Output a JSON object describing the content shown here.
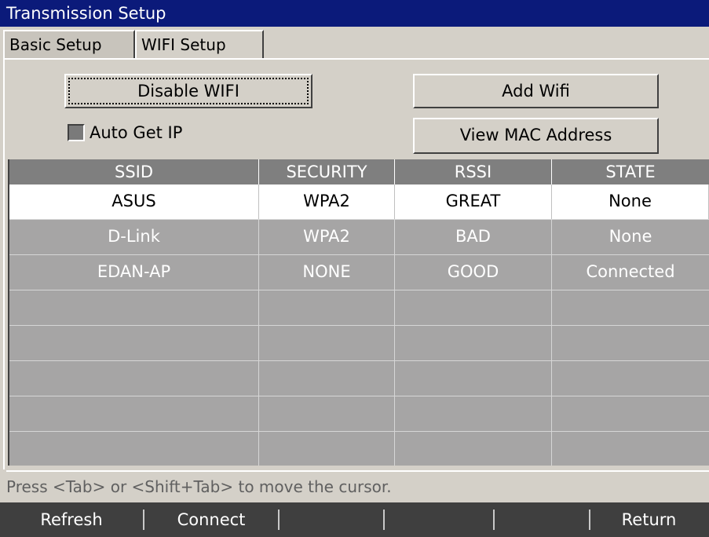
{
  "window": {
    "title": "Transmission Setup"
  },
  "tabs": [
    {
      "label": "Basic Setup"
    },
    {
      "label": "WIFI Setup"
    }
  ],
  "buttons": {
    "disable_wifi": "Disable WIFI",
    "add_wifi": "Add Wifi",
    "view_mac": "View MAC Address"
  },
  "auto_get_ip": {
    "label": "Auto Get IP",
    "checked": false
  },
  "table": {
    "headers": [
      "SSID",
      "SECURITY",
      "RSSI",
      "STATE"
    ],
    "rows": [
      [
        "ASUS",
        "WPA2",
        "GREAT",
        "None"
      ],
      [
        "D-Link",
        "WPA2",
        "BAD",
        "None"
      ],
      [
        "EDAN-AP",
        "NONE",
        "GOOD",
        "Connected"
      ],
      [
        "",
        "",
        "",
        ""
      ],
      [
        "",
        "",
        "",
        ""
      ],
      [
        "",
        "",
        "",
        ""
      ],
      [
        "",
        "",
        "",
        ""
      ],
      [
        "",
        "",
        "",
        ""
      ]
    ],
    "selected_row": 0
  },
  "status": {
    "hint": "Press <Tab> or <Shift+Tab> to move the cursor."
  },
  "footer": {
    "refresh": "Refresh",
    "connect": "Connect",
    "blank1": "",
    "blank2": "",
    "return": "Return"
  },
  "colors": {
    "titlebar": "#0b1a7a",
    "panel": "#d4d0c8",
    "table_bg": "#a6a5a5",
    "table_header": "#7f7f7f",
    "selected_row": "#ffffff",
    "footer": "#3f3f3f"
  }
}
